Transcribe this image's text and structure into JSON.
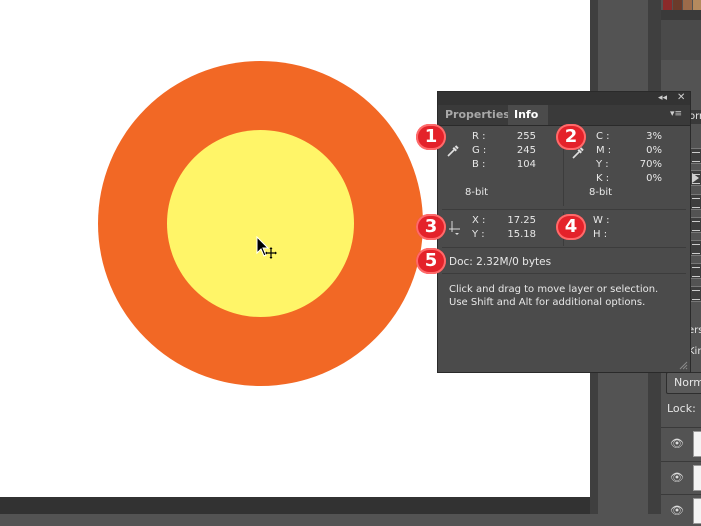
{
  "colors": {
    "ring": "#f26825",
    "center": "#fff568",
    "badge": "#e4222a",
    "panel": "#4b4b4b"
  },
  "info_panel": {
    "tabs": [
      "Properties",
      "Info"
    ],
    "active_tab": "Info",
    "rgb": {
      "labels": [
        "R :",
        "G :",
        "B :"
      ],
      "values": [
        "255",
        "245",
        "104"
      ],
      "depth": "8-bit"
    },
    "cmyk": {
      "labels": [
        "C :",
        "M :",
        "Y :",
        "K :"
      ],
      "values": [
        "3%",
        "0%",
        "70%",
        "0%"
      ],
      "depth": "8-bit"
    },
    "xy": {
      "labels": [
        "X :",
        "Y :"
      ],
      "values": [
        "17.25",
        "15.18"
      ]
    },
    "wh": {
      "labels": [
        "W :",
        "H :"
      ]
    },
    "doc": "Doc: 2.32M/0 bytes",
    "hint_line1": "Click and drag to move layer or selection.",
    "hint_line2": "Use Shift and Alt for additional options."
  },
  "badges": [
    "1",
    "2",
    "3",
    "4",
    "5"
  ],
  "right_panel": {
    "partial_tab": "orn",
    "layers_label": "ers",
    "kind_label": "Kin",
    "blend_mode": "Norm",
    "lock_label": "Lock:"
  },
  "icons": {
    "eyedropper_rgb": "eyedropper-icon",
    "eyedropper_cmyk": "eyedropper-icon",
    "crosshair": "crosshair-icon",
    "cursor": "move-cursor-icon",
    "eye": "visibility-eye-icon"
  }
}
